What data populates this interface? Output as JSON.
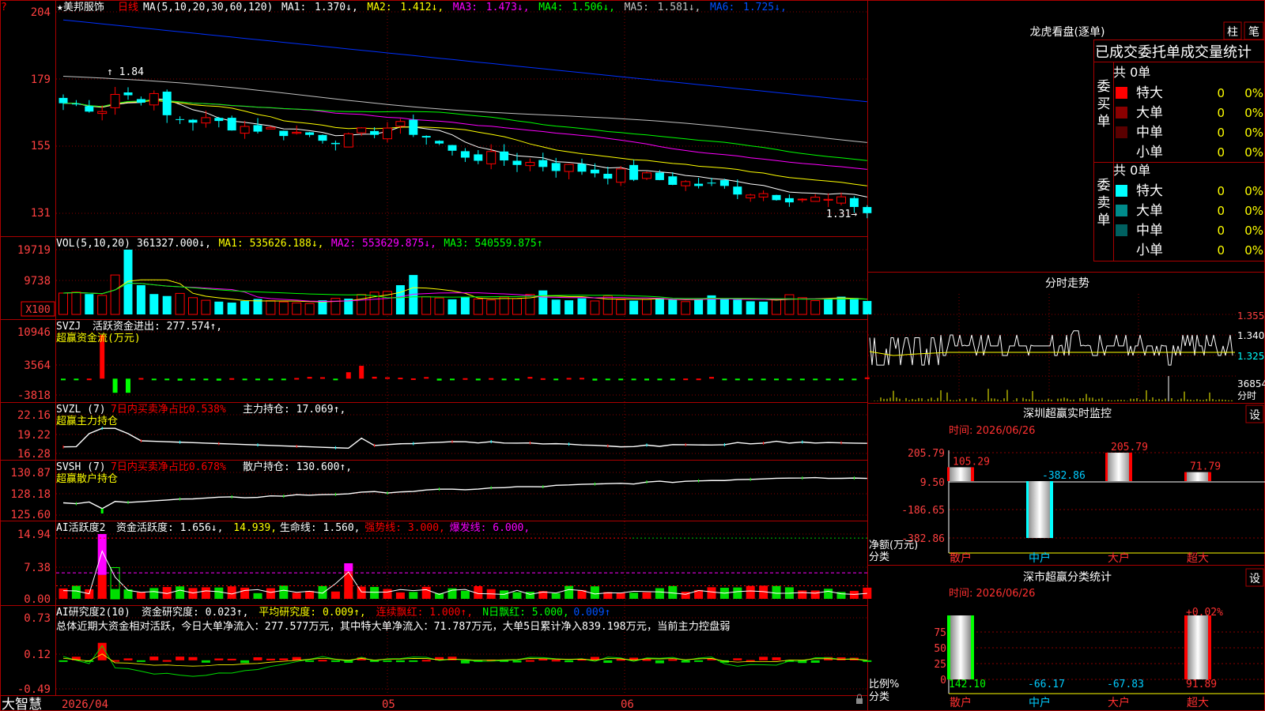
{
  "title": {
    "stock_name": "★美邦服饰",
    "period": "日线",
    "ma_label": "MA(5,10,20,30,60,120)",
    "ma_items": [
      {
        "label": "MA1:",
        "value": "1.370↓",
        "color": "#ffffff"
      },
      {
        "label": "MA2:",
        "value": "1.412↓",
        "color": "#ffff00"
      },
      {
        "label": "MA3:",
        "value": "1.473↓",
        "color": "#ff00ff"
      },
      {
        "label": "MA4:",
        "value": "1.506↓",
        "color": "#00ff00"
      },
      {
        "label": "MA5:",
        "value": "1.581↓",
        "color": "#c0c0c0"
      },
      {
        "label": "MA6:",
        "value": "1.725↓",
        "color": "#0050ff"
      }
    ]
  },
  "bottom": {
    "brand": "大智慧",
    "date_start": "2026/04",
    "month_05": "05",
    "month_06": "06"
  },
  "colors": {
    "up": "#ff0000",
    "down": "#00ffff",
    "grid": "#aa0000",
    "axis_text": "#ff4040",
    "ma1": "#ffffff",
    "ma2": "#ffff00",
    "ma3": "#ff00ff",
    "ma4": "#00ff00",
    "ma5": "#c0c0c0",
    "ma6": "#0030ff"
  },
  "panels": {
    "kline": {
      "y_ticks": [
        "204",
        "179",
        "155",
        "131"
      ],
      "high_label": "1.84",
      "low_label": "1.31"
    },
    "vol": {
      "header": "VOL(5,10,20)",
      "items": [
        {
          "text": "361327.000↓,",
          "color": "#ffffff"
        },
        {
          "text": "MA1: 535626.188↓,",
          "color": "#ffff00"
        },
        {
          "text": "MA2: 553629.875↓,",
          "color": "#ff00ff"
        },
        {
          "text": "MA3: 540559.875↑",
          "color": "#00ff00"
        }
      ],
      "y_ticks": [
        "19719",
        "9738"
      ],
      "unit": "X100"
    },
    "svzj": {
      "header": "SVZJ",
      "line1": "活跃资金进出: 277.574↑,",
      "line2": "超赢资金流(万元)",
      "y_ticks": [
        "10946",
        "3564",
        "-3818"
      ]
    },
    "svzl": {
      "header": "SVZL (7)",
      "red_text": "7日内买卖净占比0.538%",
      "white_text": "主力持仓: 17.069↑,",
      "line2": "超赢主力持仓",
      "y_ticks": [
        "22.16",
        "19.22",
        "16.28"
      ]
    },
    "svsh": {
      "header": "SVSH (7)",
      "red_text": "7日内买卖净占比0.678%",
      "white_text": "散户持仓: 130.600↑,",
      "line2": "超赢散户持仓",
      "y_ticks": [
        "130.87",
        "128.18",
        "125.60"
      ]
    },
    "ai_active": {
      "header": "AI活跃度2",
      "items": [
        {
          "text": "资金活跃度: 1.656↓,",
          "color": "#ffffff"
        },
        {
          "text": "14.939,",
          "color": "#ffff00"
        },
        {
          "text": "生命线: 1.560,",
          "color": "#ffffff"
        },
        {
          "text": "强势线: 3.000,",
          "color": "#ff0000"
        },
        {
          "text": "爆发线: 6.000,",
          "color": "#ff00ff"
        }
      ],
      "y_ticks": [
        "14.94",
        "7.38",
        "0.00"
      ]
    },
    "ai_research": {
      "header": "AI研究度2(10)",
      "items": [
        {
          "text": "资金研究度: 0.023↑,",
          "color": "#ffffff"
        },
        {
          "text": "平均研究度: 0.009↑,",
          "color": "#ffff00"
        },
        {
          "text": "连续飘红: 1.000↑,",
          "color": "#ff0000"
        },
        {
          "text": "N日飘红: 5.000,",
          "color": "#00ff00"
        },
        {
          "text": "0.009↑",
          "color": "#0050ff"
        }
      ],
      "summary": "总体近期大资金相对活跃，今日大单净流入：277.577万元，其中特大单净流入：71.787万元，大单5日累计净入839.198万元，当前主力控盘弱",
      "y_ticks": [
        "0.73",
        "0.12",
        "-0.49"
      ]
    }
  },
  "right": {
    "dragon": {
      "title": "龙虎看盘(逐单)",
      "btn1": "柱",
      "btn2": "笔",
      "stats_title": "已成交委托单成交量统计",
      "buy_group": "委买单",
      "sell_group": "委卖单",
      "buy_total": "共 0单",
      "sell_total": "共 0单",
      "buy_rows": [
        {
          "label": "特大",
          "count": "0",
          "pct": "0%",
          "color": "#ff0000"
        },
        {
          "label": "大单",
          "count": "0",
          "pct": "0%",
          "color": "#8b0000"
        },
        {
          "label": "中单",
          "count": "0",
          "pct": "0%",
          "color": "#5a0000"
        },
        {
          "label": "小单",
          "count": "0",
          "pct": "0%",
          "color": ""
        }
      ],
      "sell_rows": [
        {
          "label": "特大",
          "count": "0",
          "pct": "0%",
          "color": "#00ffff"
        },
        {
          "label": "大单",
          "count": "0",
          "pct": "0%",
          "color": "#008b8b"
        },
        {
          "label": "中单",
          "count": "0",
          "pct": "0%",
          "color": "#006060"
        },
        {
          "label": "小单",
          "count": "0",
          "pct": "0%",
          "color": ""
        }
      ]
    },
    "intraday": {
      "title": "分时走势",
      "y_ticks": [
        "1.355",
        "1.340",
        "1.325"
      ],
      "vol_tick": "36854",
      "vol_unit": "分时"
    },
    "monitor": {
      "title": "深圳超赢实时监控",
      "set_btn": "设",
      "time": "时间: 2026/06/26",
      "y_ticks": [
        "205.79",
        "9.50",
        "-186.65",
        "-382.86"
      ],
      "axis_label1": "净额(万元)",
      "axis_label2": "分类",
      "bars": [
        {
          "cat": "散户",
          "value": 105.29,
          "label": "105.29"
        },
        {
          "cat": "中户",
          "value": -382.86,
          "label": "-382.86"
        },
        {
          "cat": "大户",
          "value": 205.79,
          "label": "205.79"
        },
        {
          "cat": "超大",
          "value": 71.79,
          "label": "71.79"
        }
      ]
    },
    "classify": {
      "title": "深市超赢分类统计",
      "set_btn": "设",
      "time": "时间: 2026/06/26",
      "y_ticks": [
        "75",
        "50",
        "25",
        "0"
      ],
      "axis_label1": "比例%",
      "axis_label2": "分类",
      "top_label": "+0.02%",
      "bars": [
        {
          "cat": "散户",
          "value": 142.1,
          "label": "142.10"
        },
        {
          "cat": "中户",
          "value": -66.17,
          "label": "-66.17"
        },
        {
          "cat": "大户",
          "value": -67.83,
          "label": "-67.83"
        },
        {
          "cat": "超大",
          "value": 91.89,
          "label": "91.89"
        }
      ]
    }
  },
  "chart_data": [
    {
      "type": "candlestick",
      "title": "★美邦服饰 日线",
      "x": [
        "2026/04",
        "05",
        "06"
      ],
      "ylim": [
        1.28,
        2.06
      ],
      "high": 1.84,
      "low": 1.31,
      "close_last": 1.31,
      "ma": {
        "MA1": 1.37,
        "MA2": 1.412,
        "MA3": 1.473,
        "MA4": 1.506,
        "MA5": 1.581,
        "MA6": 1.725
      }
    },
    {
      "type": "bar",
      "title": "VOL(5,10,20)",
      "values_x100": [
        6500,
        6800,
        6200,
        5800,
        12000,
        19719,
        8900,
        6200,
        5600,
        6400,
        5100,
        4300,
        3900,
        3600,
        4100,
        4700,
        4200,
        3800,
        3500,
        3300,
        4300,
        4900,
        4800,
        6100,
        6800,
        7000,
        8900,
        12000,
        5400,
        5000,
        4600,
        5200,
        4700,
        4400,
        5300,
        4800,
        6100,
        7300,
        4500,
        4300,
        4900,
        4100,
        5600,
        4500,
        4200,
        4600,
        5000,
        4500,
        3900,
        4600,
        5800,
        4800,
        4500,
        4000,
        3900,
        4600,
        6000,
        5100,
        4200,
        4600,
        5400,
        5000,
        4100
      ],
      "ylim": [
        0,
        19719
      ],
      "unit": "X100"
    },
    {
      "type": "bar",
      "title": "SVZJ 超赢资金流(万元)",
      "ylim": [
        -3818,
        10946
      ],
      "last": 277.574
    },
    {
      "type": "line",
      "title": "SVZL 超赢主力持仓",
      "ylim": [
        16.28,
        22.16
      ],
      "last": 17.069
    },
    {
      "type": "line",
      "title": "SVSH 超赢散户持仓",
      "ylim": [
        125.6,
        130.87
      ],
      "last": 130.6
    },
    {
      "type": "bar",
      "title": "AI活跃度2",
      "ylim": [
        0.0,
        14.94
      ],
      "lines": {
        "生命线": 1.56,
        "强势线": 3.0,
        "爆发线": 6.0
      },
      "last": 1.656
    },
    {
      "type": "bar",
      "title": "AI研究度2(10)",
      "ylim": [
        -0.49,
        0.73
      ],
      "last": 0.023
    },
    {
      "type": "bar",
      "title": "深圳超赢实时监控",
      "categories": [
        "散户",
        "中户",
        "大户",
        "超大"
      ],
      "values": [
        105.29,
        -382.86,
        205.79,
        71.79
      ],
      "ylim": [
        -382.86,
        205.79
      ],
      "ylabel": "净额(万元)"
    },
    {
      "type": "bar",
      "title": "深市超赢分类统计",
      "categories": [
        "散户",
        "中户",
        "大户",
        "超大"
      ],
      "values": [
        142.1,
        -66.17,
        -67.83,
        91.89
      ],
      "ylim": [
        0,
        75
      ],
      "ylabel": "比例%"
    }
  ]
}
